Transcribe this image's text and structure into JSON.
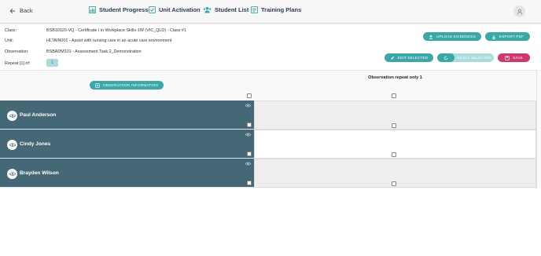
{
  "header": {
    "back_label": "Back",
    "nav": [
      {
        "label": "Student Progress",
        "icon": "bar-chart-icon"
      },
      {
        "label": "Unit Activation",
        "icon": "checklist-icon"
      },
      {
        "label": "Student List",
        "icon": "people-icon"
      },
      {
        "label": "Training Plans",
        "icon": "document-icon"
      }
    ],
    "avatar_icon": "user-icon"
  },
  "info": {
    "class_label": "Class:",
    "class_value": "BSB10120-VQ - Certificate I in Workplace Skills-1W (VIC_QLD) - Class #1",
    "unit_label": "Unit:",
    "unit_value": "HLTAIN001 - Assist with nursing care in an acute care environment",
    "observation_label": "Observation:",
    "observation_value": "BSBADM101 - Assessment Task 2_Demonstration",
    "repeat_label": "Repeat [1] of:",
    "repeat_value": "1"
  },
  "actions": {
    "upload_evidences": "UPLOAD EVIDENCES",
    "export_pdf": "EXPORT PDF",
    "edit_selected": "EDIT SELECTED",
    "reset_selected": "RESET SELECTED",
    "save": "SAVE",
    "observation_information": "OBSERVATION INFORMATION"
  },
  "grid": {
    "column_header": "Observation repeat only 1",
    "students": [
      {
        "name": "Paul Anderson"
      },
      {
        "name": "Cindy Jones"
      },
      {
        "name": "Brayden Wilson"
      }
    ]
  },
  "colors": {
    "accent_teal": "#3aa7a8",
    "save_pink": "#d1356b",
    "student_row": "#456876"
  }
}
